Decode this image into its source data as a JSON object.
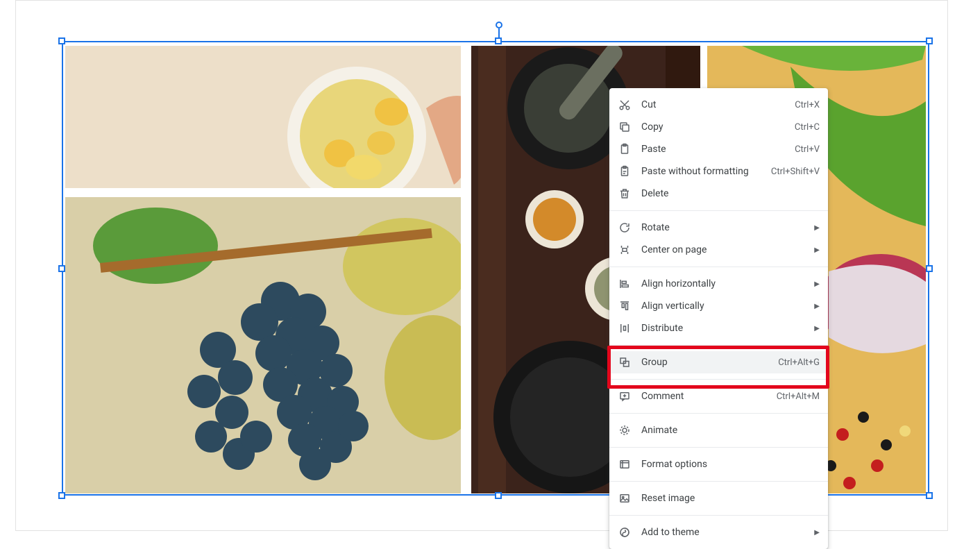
{
  "menu": {
    "cut": {
      "label": "Cut",
      "shortcut": "Ctrl+X"
    },
    "copy": {
      "label": "Copy",
      "shortcut": "Ctrl+C"
    },
    "paste": {
      "label": "Paste",
      "shortcut": "Ctrl+V"
    },
    "paste_wf": {
      "label": "Paste without formatting",
      "shortcut": "Ctrl+Shift+V"
    },
    "delete": {
      "label": "Delete"
    },
    "rotate": {
      "label": "Rotate"
    },
    "center": {
      "label": "Center on page"
    },
    "align_h": {
      "label": "Align horizontally"
    },
    "align_v": {
      "label": "Align vertically"
    },
    "distribute": {
      "label": "Distribute"
    },
    "group": {
      "label": "Group",
      "shortcut": "Ctrl+Alt+G"
    },
    "comment": {
      "label": "Comment",
      "shortcut": "Ctrl+Alt+M"
    },
    "animate": {
      "label": "Animate"
    },
    "format": {
      "label": "Format options"
    },
    "reset": {
      "label": "Reset image"
    },
    "theme": {
      "label": "Add to theme"
    }
  }
}
